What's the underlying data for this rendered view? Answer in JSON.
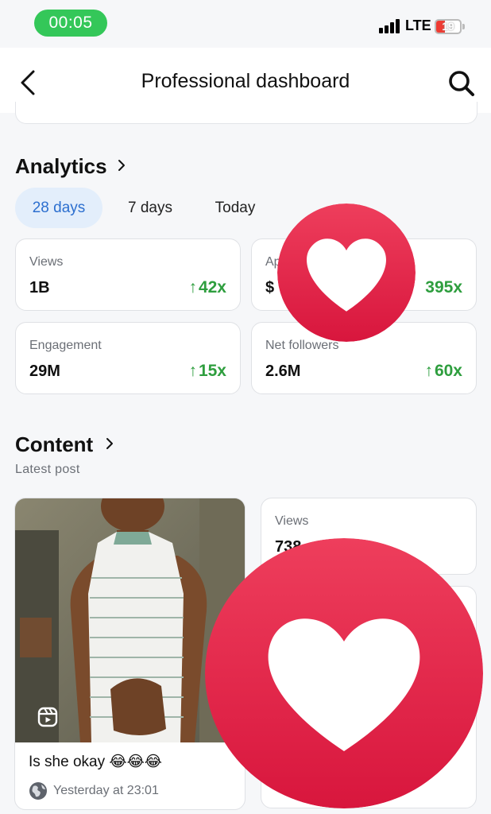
{
  "status_bar": {
    "time": "00:05",
    "network": "LTE",
    "battery": "19"
  },
  "header": {
    "title": "Professional dashboard"
  },
  "analytics": {
    "title": "Analytics",
    "ranges": [
      "28 days",
      "7 days",
      "Today"
    ],
    "selected_range": "28 days",
    "stats": [
      {
        "label": "Views",
        "value": "1B",
        "delta_arrow": "↑",
        "delta": "42x"
      },
      {
        "label": "Ap",
        "value": "$",
        "delta_arrow": "",
        "delta": "395x"
      },
      {
        "label": "Engagement",
        "value": "29M",
        "delta_arrow": "↑",
        "delta": "15x"
      },
      {
        "label": "Net followers",
        "value": "2.6M",
        "delta_arrow": "↑",
        "delta": "60x"
      }
    ]
  },
  "content": {
    "title": "Content",
    "subtitle": "Latest post",
    "post": {
      "caption": "Is she okay 😂😂😂",
      "timestamp": "Yesterday at 23:01"
    },
    "side_stat": {
      "label": "Views",
      "value": "738"
    }
  },
  "colors": {
    "accent_blue": "#2c6fcf",
    "growth_green": "#2e9e3e",
    "heart_red": "#e8244a"
  },
  "icons": [
    "back-icon",
    "search-icon",
    "chevron-right-icon",
    "reel-icon",
    "globe-icon",
    "heart-icon"
  ]
}
